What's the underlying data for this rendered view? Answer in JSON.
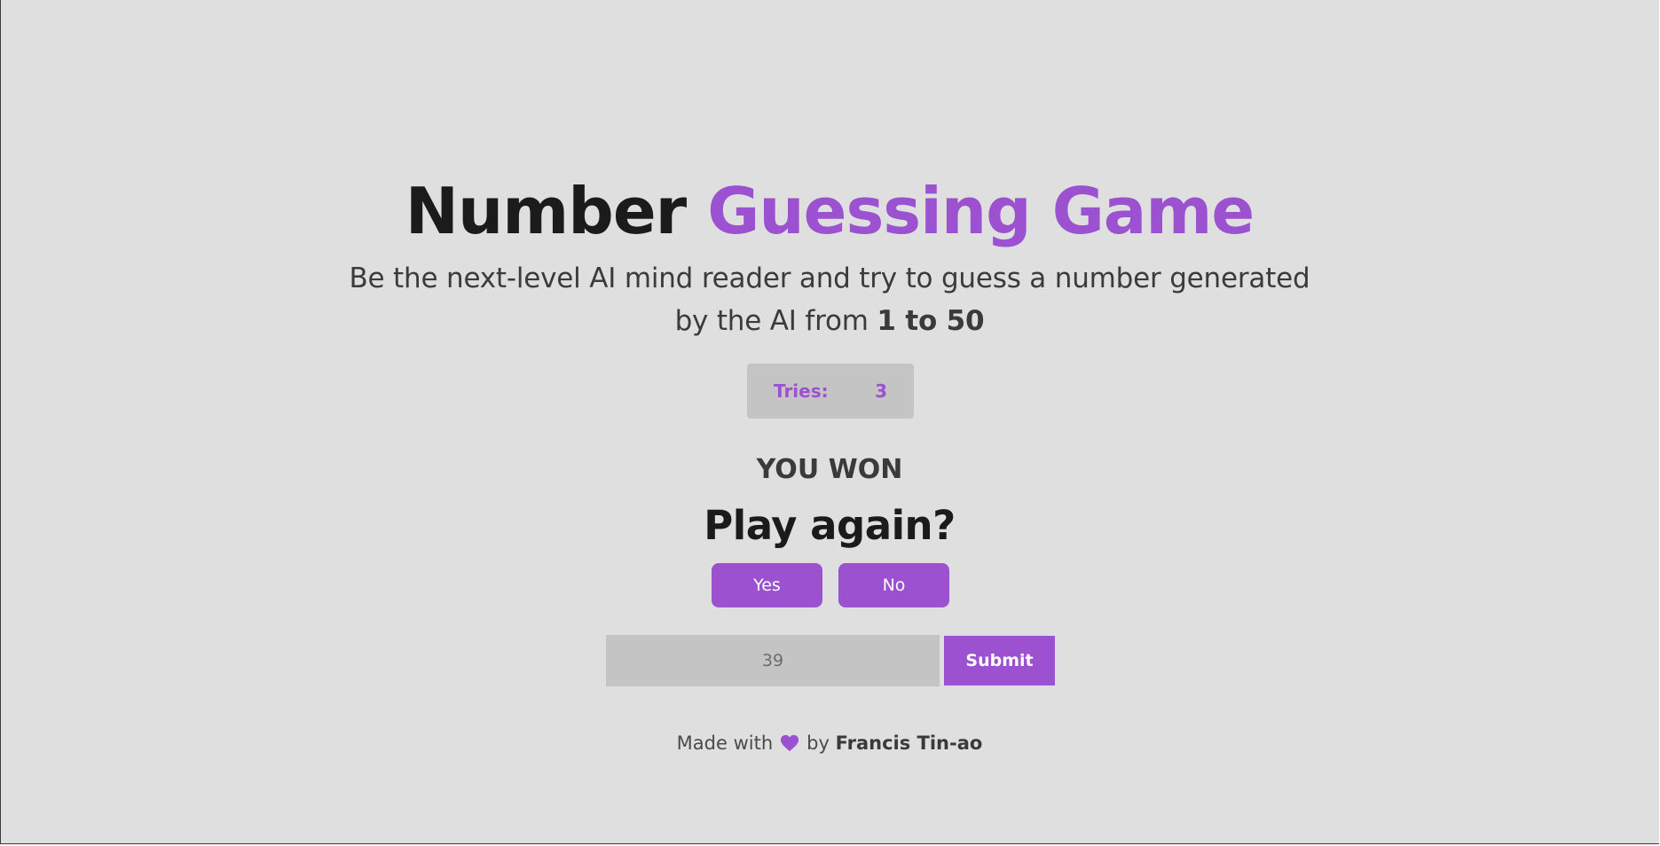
{
  "header": {
    "title_part1": "Number",
    "title_part2": "Guessing Game",
    "subtitle_text": "Be the next-level AI mind reader and try to guess a number generated by the AI from",
    "subtitle_range": "1 to 50"
  },
  "tries": {
    "label": "Tries:",
    "value": "3"
  },
  "result": {
    "status": "YOU WON",
    "prompt": "Play again?",
    "yes_label": "Yes",
    "no_label": "No"
  },
  "guess": {
    "placeholder": "39",
    "submit_label": "Submit"
  },
  "footer": {
    "prefix": "Made with",
    "heart_icon": "heart-icon",
    "by": "by",
    "author": "Francis Tin-ao"
  },
  "colors": {
    "accent": "#9b51d0",
    "background": "#dfdfdf",
    "panel": "#c4c4c4",
    "text_dark": "#1b1b1b"
  }
}
